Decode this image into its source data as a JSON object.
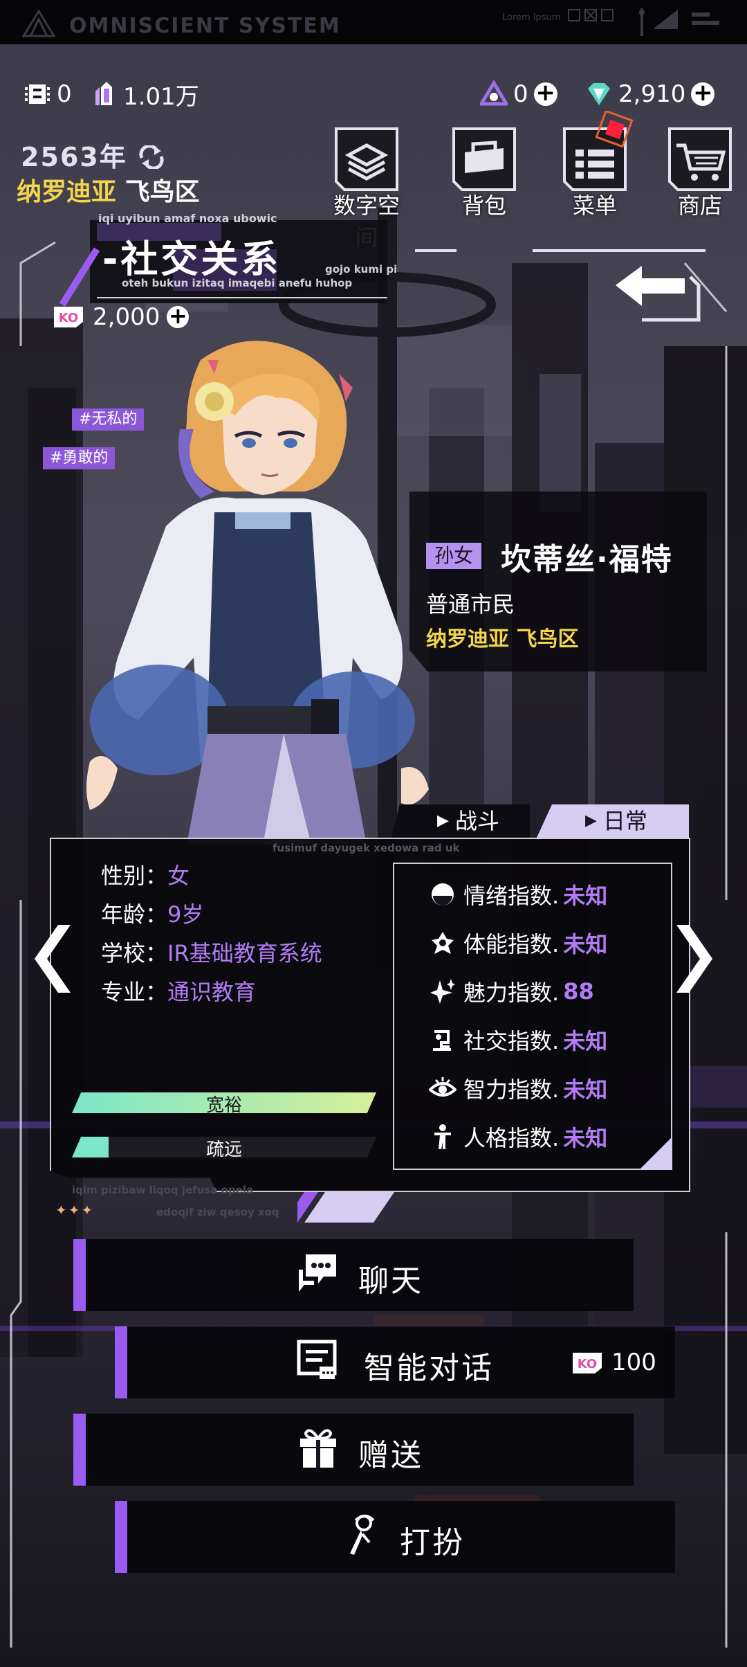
{
  "system": {
    "title": "OMNISCIENT SYSTEM",
    "lorem": "Lorem ipsum"
  },
  "currency": {
    "chip_value": "0",
    "crystal_value": "1.01万",
    "triangle_value": "0",
    "diamond_value": "2,910"
  },
  "date": {
    "year": "2563年",
    "city": "纳罗迪亚",
    "district": "飞鸟区"
  },
  "nav": [
    {
      "label": "数字空间",
      "icon": "layers-icon"
    },
    {
      "label": "背包",
      "icon": "bag-icon"
    },
    {
      "label": "菜单",
      "icon": "menu-icon"
    },
    {
      "label": "商店",
      "icon": "cart-icon"
    }
  ],
  "section": {
    "caption_top": "iqi uyibun amaf noxa ubowic",
    "title": "-社交关系",
    "caption_bottom": "oteh bukun izitaq imaqebi anefu huhop",
    "caption_side": "gojo kumi pi"
  },
  "social_currency": {
    "value": "2,000"
  },
  "tags": [
    "#无私的",
    "#勇敢的"
  ],
  "character": {
    "relation": "孙女",
    "name": "坎蒂丝·福特",
    "status": "普通市民",
    "location": "纳罗迪亚 飞鸟区"
  },
  "tabs": {
    "battle": "战斗",
    "daily": "日常",
    "active": "daily"
  },
  "info": {
    "caption_top": "fusimuf dayugek xedowa rad uk",
    "caption_bottom1": "iqim pizibaw liqoq jefusa opela",
    "caption_bottom2": "edoqif ziw qesoy xoq",
    "rows": [
      {
        "key": "性别：",
        "value": "女"
      },
      {
        "key": "年龄：",
        "value": "9岁"
      },
      {
        "key": "学校：",
        "value": "IR基础教育系统"
      },
      {
        "key": "专业：",
        "value": "通识教育"
      }
    ],
    "bars": [
      {
        "label": "宽裕",
        "level": 1.0
      },
      {
        "label": "疏远",
        "level": 0.12
      }
    ],
    "stats": [
      {
        "label": "情绪指数.",
        "value": "未知",
        "icon": "mood-icon"
      },
      {
        "label": "体能指数.",
        "value": "未知",
        "icon": "fitness-icon"
      },
      {
        "label": "魅力指数.",
        "value": "88",
        "icon": "sparkle-icon"
      },
      {
        "label": "社交指数.",
        "value": "未知",
        "icon": "social-icon"
      },
      {
        "label": "智力指数.",
        "value": "未知",
        "icon": "eye-icon"
      },
      {
        "label": "人格指数.",
        "value": "未知",
        "icon": "person-icon"
      }
    ]
  },
  "actions": [
    {
      "label": "聊天",
      "icon": "chat-icon"
    },
    {
      "label": "智能对话",
      "icon": "dialog-icon",
      "cost": "100"
    },
    {
      "label": "赠送",
      "icon": "gift-icon"
    },
    {
      "label": "打扮",
      "icon": "dressup-icon"
    }
  ],
  "colors": {
    "accent": "#9a5bf0",
    "highlight": "#b27cf5",
    "gold": "#f3d64b",
    "tab_active": "#d7cdf2"
  }
}
